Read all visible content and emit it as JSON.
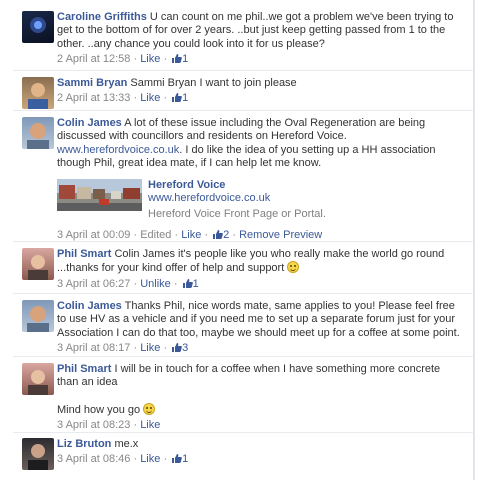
{
  "comments": [
    {
      "name": "Caroline Griffiths",
      "text": "U can count on me phil..we got a problem we've been trying to get to the bottom of for over 2 years. ..but just keep getting passed from 1 to the other. ..any chance you could look into it for us please?",
      "time": "2 April at 12:58",
      "like_label": "Like",
      "like_count": "1"
    },
    {
      "name": "Sammi Bryan",
      "text": "Sammi Bryan I want to join please",
      "time": "2 April at 13:33",
      "like_label": "Like",
      "like_count": "1"
    },
    {
      "name": "Colin James",
      "text_before_link": "A lot of these issue including the Oval Regeneration are being discussed with councillors and residents on Hereford Voice.",
      "link": "www.herefordvoice.co.uk",
      "text_after_link": ". I do like the idea of you setting up a HH association though Phil, great idea mate, if I can help let me know.",
      "preview_title": "Hereford Voice",
      "preview_url": "www.herefordvoice.co.uk",
      "preview_desc": "Hereford Voice Front Page or Portal.",
      "time": "3 April at 00:09",
      "edited": "Edited",
      "like_label": "Like",
      "like_count": "2",
      "remove_preview": "Remove Preview"
    },
    {
      "name": "Phil Smart",
      "text": "Colin James it's people like you who really make the world go round ...thanks for your kind offer of help and support",
      "time": "3 April at 06:27",
      "like_label": "Unlike",
      "like_count": "1"
    },
    {
      "name": "Colin James",
      "text": "Thanks Phil, nice words mate, same applies to you! Please feel free to use HV as a vehicle and if you need me to set up a separate forum just for your Association I can do that too, maybe we should meet up for a coffee at some point.",
      "time": "3 April at 08:17",
      "like_label": "Like",
      "like_count": "3"
    },
    {
      "name": "Phil Smart",
      "text": "I will be in touch for a coffee when I have something more concrete than an idea",
      "text2": "Mind how you go",
      "time": "3 April at 08:23",
      "like_label": "Like"
    },
    {
      "name": "Liz Bruton",
      "text": "me.x",
      "time": "3 April at 08:46",
      "like_label": "Like",
      "like_count": "1"
    }
  ],
  "separator": "·",
  "colors": {
    "link": "#3b5998",
    "meta": "#888888",
    "text": "#333333"
  }
}
